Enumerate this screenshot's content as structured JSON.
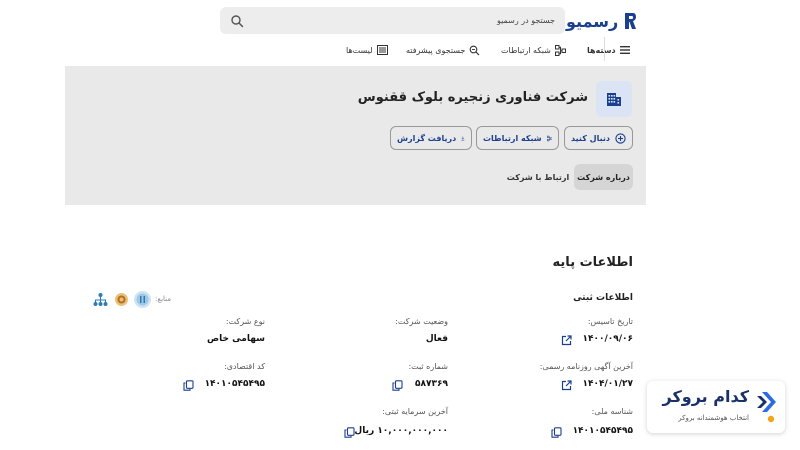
{
  "header": {
    "logo_text": "رسمیو",
    "search_placeholder": "جستجو در رسمیو"
  },
  "nav": {
    "categories": "دسته‌ها",
    "network": "شبکه ارتباطات",
    "advanced_search": "جستجوی پیشرفته",
    "lists": "لیست‌ها"
  },
  "company": {
    "title": "شرکت فناوری زنجیره بلوک ققنوس",
    "actions": {
      "follow": "دنبال کنید",
      "network": "شبکه ارتباطات",
      "report": "دریافت گزارش"
    },
    "tabs": {
      "about": "درباره شرکت",
      "contact": "ارتباط با شرکت"
    }
  },
  "info": {
    "section_title": "اطلاعات پایه",
    "subsection_title": "اطلاعات ثبتی",
    "sources_label": "منابع:",
    "fields": {
      "establish_date": {
        "label": "تاریخ تاسیس:",
        "value": "۱۴۰۰/۰۹/۰۶"
      },
      "status": {
        "label": "وضعیت شرکت:",
        "value": "فعال"
      },
      "company_type": {
        "label": "نوع شرکت:",
        "value": "سهامی خاص"
      },
      "last_notice": {
        "label": "آخرین آگهی روزنامه رسمی:",
        "value": "۱۴۰۴/۰۱/۲۷"
      },
      "reg_number": {
        "label": "شماره ثبت:",
        "value": "۵۸۷۳۶۹"
      },
      "economic_code": {
        "label": "کد اقتصادی:",
        "value": "۱۴۰۱۰۵۴۵۴۹۵"
      },
      "national_id": {
        "label": "شناسه ملی:",
        "value": "۱۴۰۱۰۵۴۵۴۹۵"
      },
      "capital": {
        "label": "آخرین سرمایه ثبتی:",
        "value": "۱۰,۰۰۰,۰۰۰,۰۰۰ ریال"
      }
    }
  },
  "broker_widget": {
    "name": "کدام بروکر",
    "tagline": "انتخاب هوشمندانه بروکر"
  },
  "colors": {
    "brand": "#1b3f8f",
    "banner": "#e9e9e9",
    "active_tab": "#d5d5d5",
    "broker_accent": "#2b6de0",
    "broker_dot": "#f2a51a"
  }
}
